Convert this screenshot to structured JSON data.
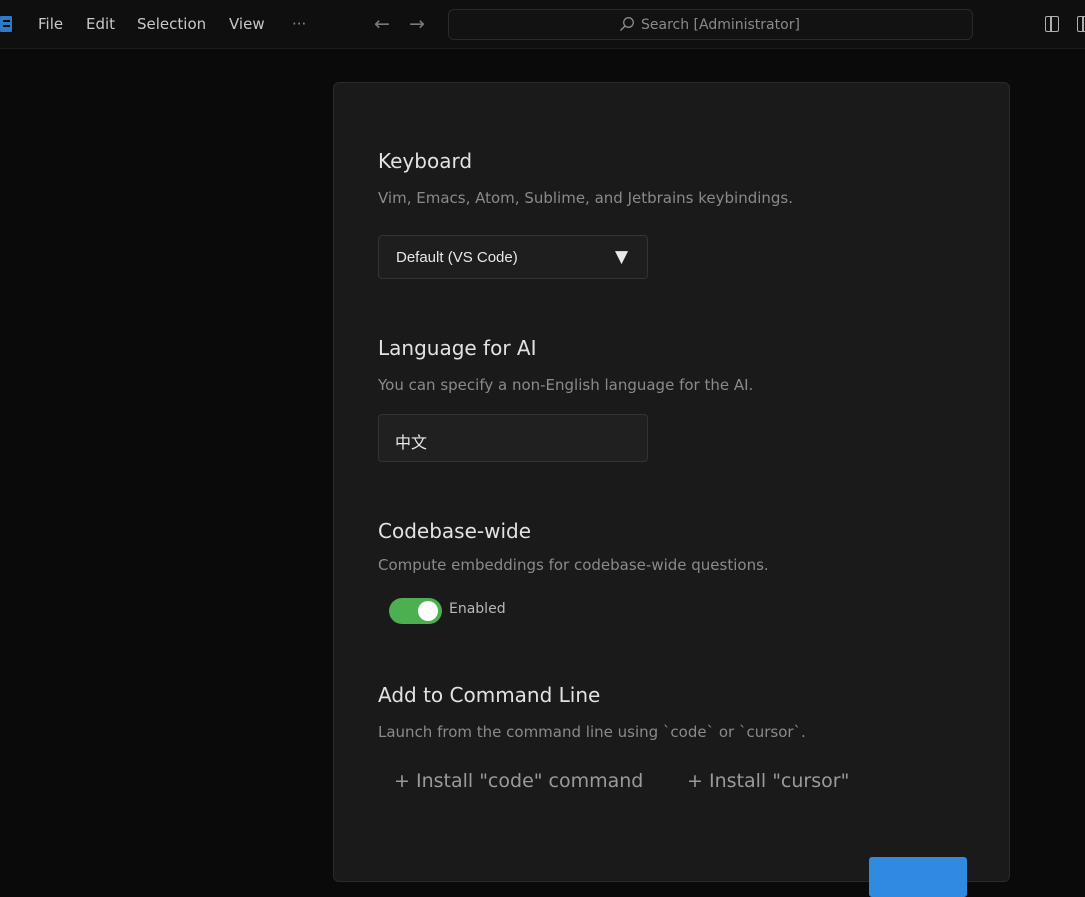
{
  "menu": {
    "items": [
      "File",
      "Edit",
      "Selection",
      "View"
    ],
    "more": "···"
  },
  "nav": {
    "back": "←",
    "forward": "→"
  },
  "search": {
    "placeholder": "Search [Administrator]"
  },
  "settings": {
    "keyboard": {
      "title": "Keyboard",
      "description": "Vim, Emacs, Atom, Sublime, and Jetbrains keybindings.",
      "selected": "Default (VS Code)"
    },
    "language": {
      "title": "Language for AI",
      "description": "You can specify a non-English language for the AI.",
      "value": "中文"
    },
    "codebase": {
      "title": "Codebase-wide",
      "description": "Compute embeddings for codebase-wide questions.",
      "toggle_label": "Enabled",
      "enabled": true
    },
    "command_line": {
      "title": "Add to Command Line",
      "description": "Launch from the command line using `code` or `cursor`.",
      "install_code": "+ Install \"code\" command",
      "install_cursor": "+ Install \"cursor\""
    }
  },
  "colors": {
    "toggle_on": "#4caf50",
    "primary_button": "#2f8ae0",
    "highlight": "#d40000"
  }
}
